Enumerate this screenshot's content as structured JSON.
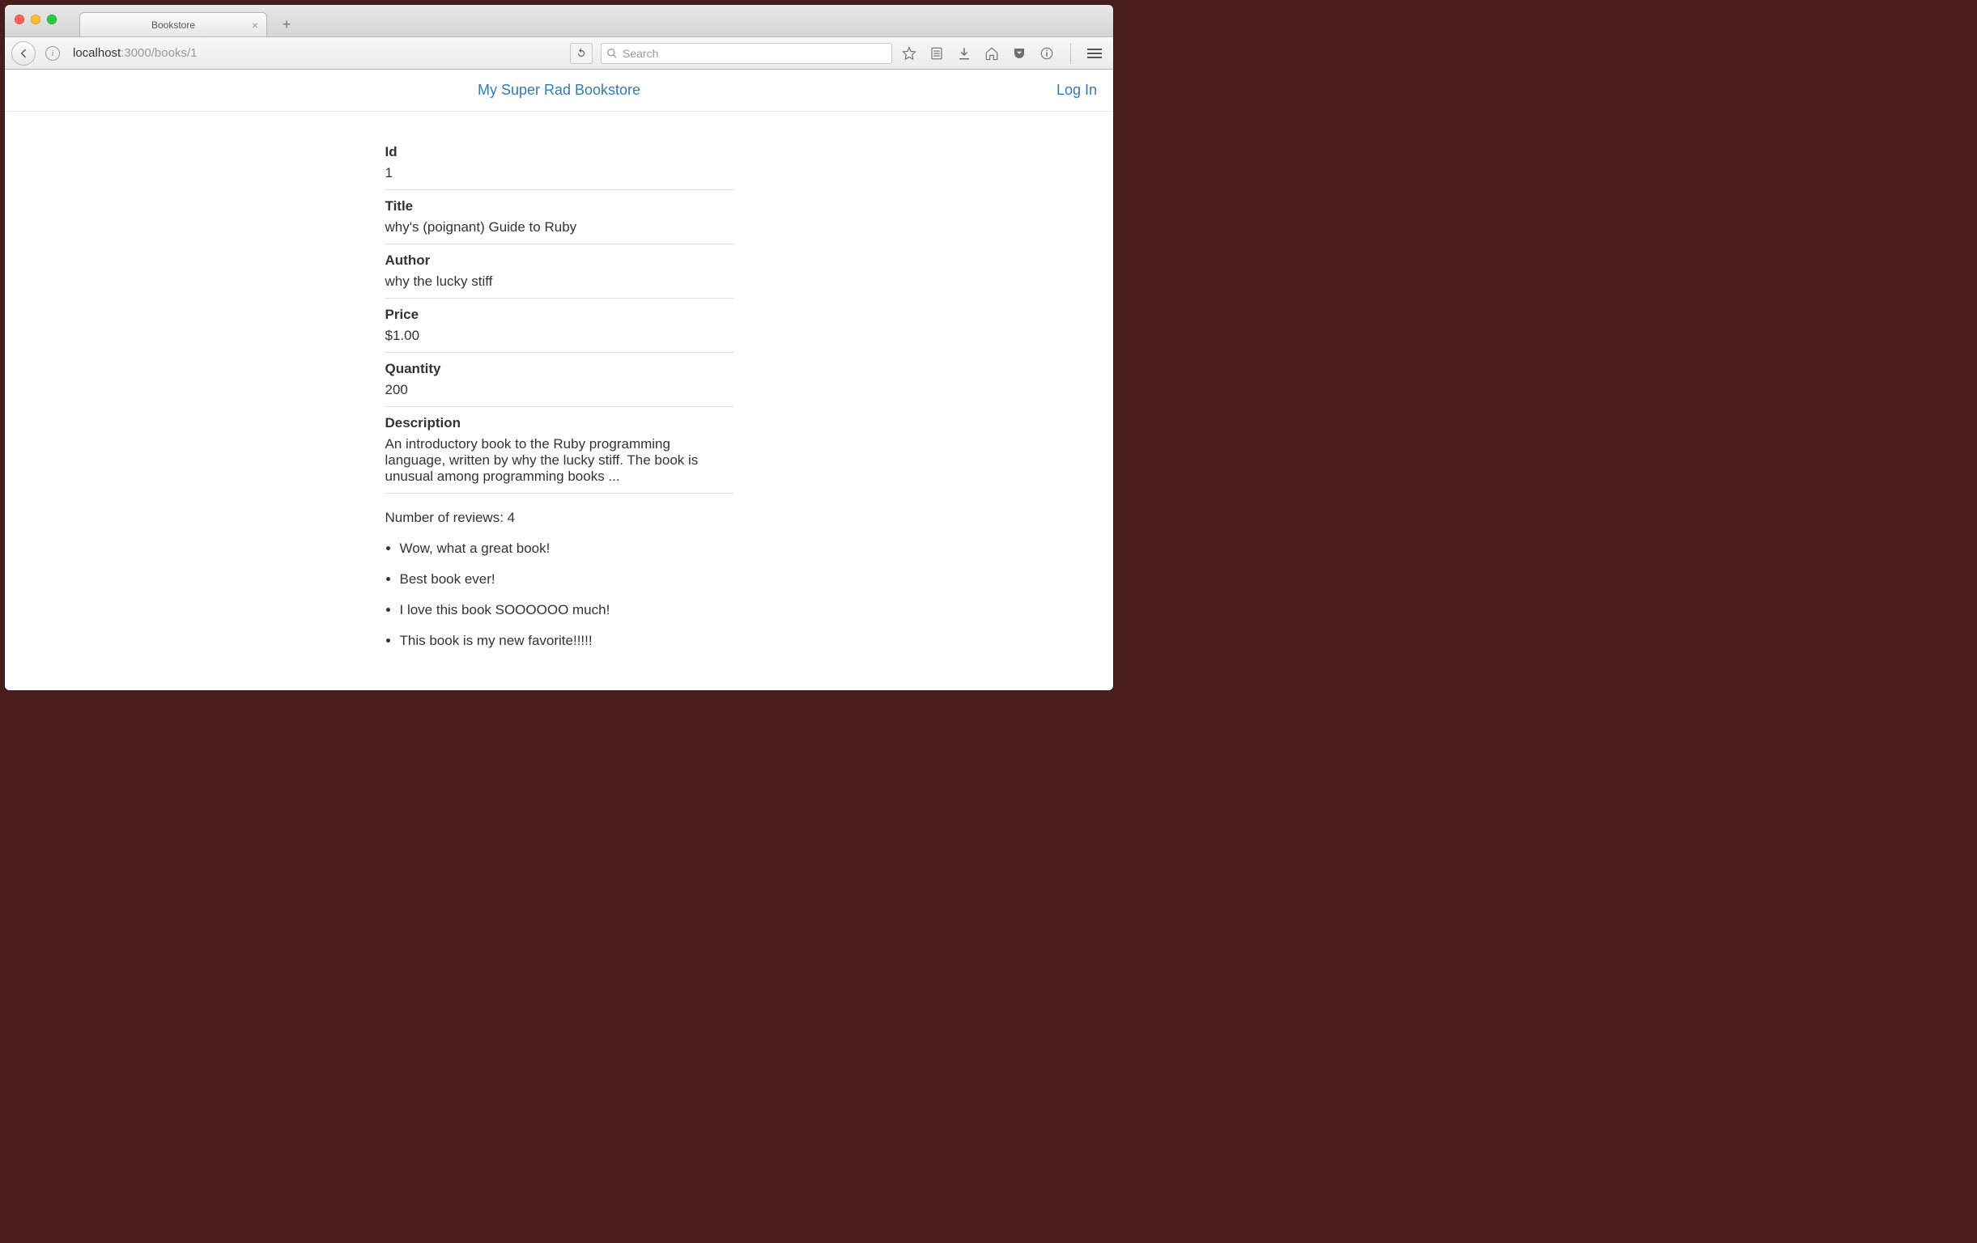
{
  "browser": {
    "tab_title": "Bookstore",
    "url_host_prefix": "localhost",
    "url_host_suffix": ":3000",
    "url_path": "/books/1",
    "search_placeholder": "Search"
  },
  "nav": {
    "brand": "My Super Rad Bookstore",
    "login": "Log In"
  },
  "labels": {
    "id": "Id",
    "title": "Title",
    "author": "Author",
    "price": "Price",
    "quantity": "Quantity",
    "description": "Description",
    "reviews_prefix": "Number of reviews: "
  },
  "book": {
    "id": "1",
    "title": "why's (poignant) Guide to Ruby",
    "author": "why the lucky stiff",
    "price": "$1.00",
    "quantity": "200",
    "description": "An introductory book to the Ruby programming language, written by why the lucky stiff. The book is unusual among programming books ..."
  },
  "reviews_count": "4",
  "reviews": [
    "Wow, what a great book!",
    "Best book ever!",
    "I love this book SOOOOOO much!",
    "This book is my new favorite!!!!!"
  ]
}
